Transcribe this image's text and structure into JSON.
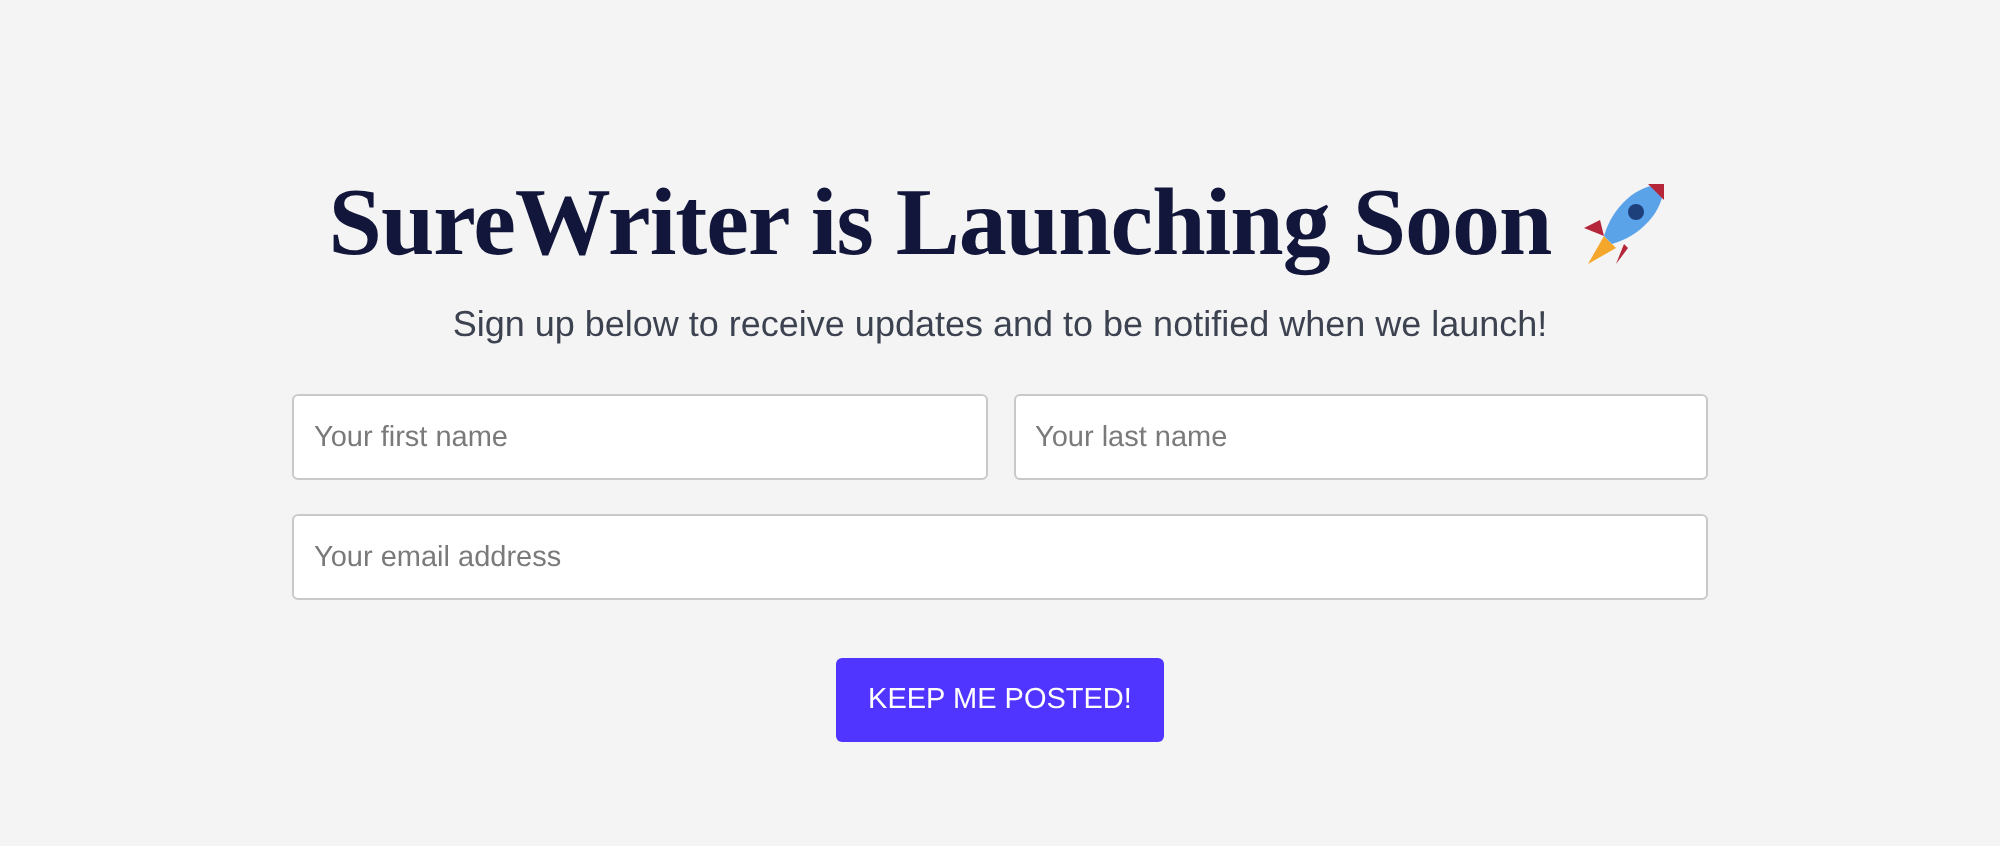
{
  "title": "SureWriter is Launching Soon",
  "subtitle": "Sign up below to receive updates and to be notified when we launch!",
  "fields": [
    {
      "placeholder": "Your first name"
    },
    {
      "placeholder": "Your last name"
    },
    {
      "placeholder": "Your email address"
    }
  ],
  "button": "KEEP ME POSTED!"
}
